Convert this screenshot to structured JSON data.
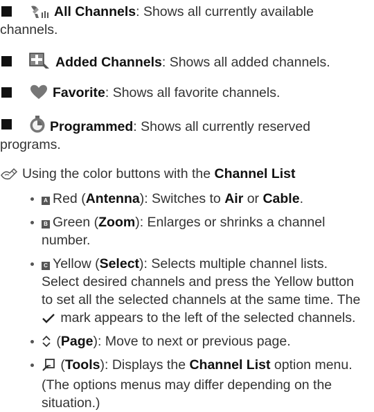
{
  "bullets_top": [
    {
      "icon": "all-channels-icon",
      "name": "All Channels",
      "desc": ": Shows all currently available channels."
    },
    {
      "icon": "added-channels-icon",
      "name": "Added Channels",
      "desc": ": Shows all added channels."
    },
    {
      "icon": "heart-icon",
      "name": "Favorite",
      "desc": ": Shows all favorite channels."
    },
    {
      "icon": "clock-icon",
      "name": "Programmed",
      "desc": ": Shows all currently reserved programs."
    }
  ],
  "note": {
    "icon": "note-pencil-icon",
    "prefix": "Using the color buttons with the ",
    "bold": "Channel List"
  },
  "color_buttons": [
    {
      "key": "A",
      "color": "Red",
      "paren": "Antenna",
      "text": "Switches to ",
      "b1": "Air",
      "mid": " or ",
      "b2": "Cable",
      "end": "."
    },
    {
      "key": "B",
      "color": "Green",
      "paren": "Zoom",
      "text": "Enlarges or shrinks a channel number."
    },
    {
      "key": "C",
      "color": "Yellow",
      "paren": "Select",
      "text1": "Selects multiple channel lists. Select desired channels and press the Yellow button to set all the selected channels at the same time. The ",
      "text2": " mark appears to the left of the selected channels."
    },
    {
      "icon": "page-arrows-icon",
      "paren": "Page",
      "text": "Move to next or previous page."
    },
    {
      "icon": "tools-icon",
      "paren": "Tools",
      "text1": "Displays the ",
      "bold": "Channel List",
      "text2": " option menu. (The options menus may differ depending on the situation.)"
    }
  ],
  "colors": {
    "text": "#333333",
    "bold": "#111111",
    "icon": "#555555"
  }
}
